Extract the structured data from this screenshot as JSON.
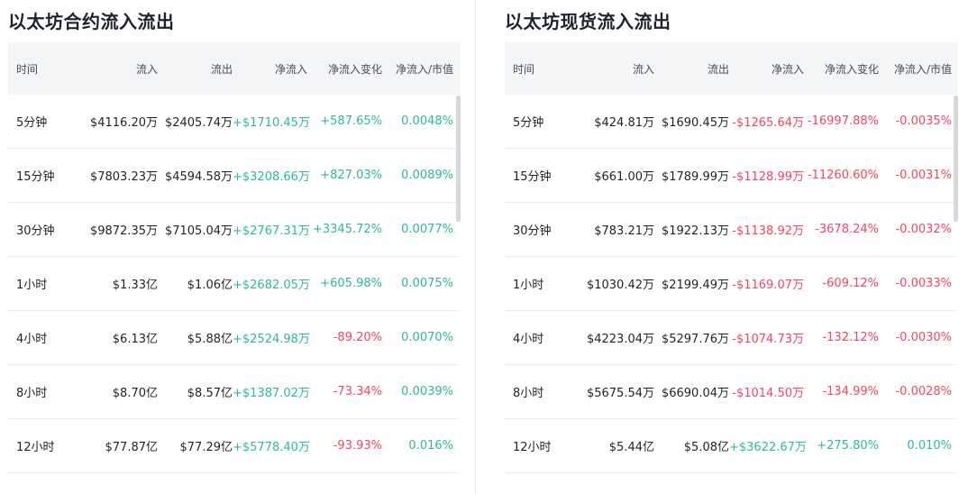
{
  "colors": {
    "positive": "#2ebd85",
    "negative": "#f6465d"
  },
  "panels": [
    {
      "title": "以太坊合约流入流出",
      "headers": [
        "时间",
        "流入",
        "流出",
        "净流入",
        "净流入变化",
        "净流入/市值"
      ],
      "rows": [
        {
          "time": "5分钟",
          "inflow": "$4116.20万",
          "outflow": "$2405.74万",
          "net": "+$1710.45万",
          "net_dir": "pos",
          "change": "+587.65%",
          "change_dir": "pos",
          "ratio": "0.0048%",
          "ratio_dir": "pos"
        },
        {
          "time": "15分钟",
          "inflow": "$7803.23万",
          "outflow": "$4594.58万",
          "net": "+$3208.66万",
          "net_dir": "pos",
          "change": "+827.03%",
          "change_dir": "pos",
          "ratio": "0.0089%",
          "ratio_dir": "pos"
        },
        {
          "time": "30分钟",
          "inflow": "$9872.35万",
          "outflow": "$7105.04万",
          "net": "+$2767.31万",
          "net_dir": "pos",
          "change": "+3345.72%",
          "change_dir": "pos",
          "ratio": "0.0077%",
          "ratio_dir": "pos"
        },
        {
          "time": "1小时",
          "inflow": "$1.33亿",
          "outflow": "$1.06亿",
          "net": "+$2682.05万",
          "net_dir": "pos",
          "change": "+605.98%",
          "change_dir": "pos",
          "ratio": "0.0075%",
          "ratio_dir": "pos"
        },
        {
          "time": "4小时",
          "inflow": "$6.13亿",
          "outflow": "$5.88亿",
          "net": "+$2524.98万",
          "net_dir": "pos",
          "change": "-89.20%",
          "change_dir": "neg",
          "ratio": "0.0070%",
          "ratio_dir": "pos"
        },
        {
          "time": "8小时",
          "inflow": "$8.70亿",
          "outflow": "$8.57亿",
          "net": "+$1387.02万",
          "net_dir": "pos",
          "change": "-73.34%",
          "change_dir": "neg",
          "ratio": "0.0039%",
          "ratio_dir": "pos"
        },
        {
          "time": "12小时",
          "inflow": "$77.87亿",
          "outflow": "$77.29亿",
          "net": "+$5778.40万",
          "net_dir": "pos",
          "change": "-93.93%",
          "change_dir": "neg",
          "ratio": "0.016%",
          "ratio_dir": "pos"
        }
      ]
    },
    {
      "title": "以太坊现货流入流出",
      "headers": [
        "时间",
        "流入",
        "流出",
        "净流入",
        "净流入变化",
        "净流入/市值"
      ],
      "rows": [
        {
          "time": "5分钟",
          "inflow": "$424.81万",
          "outflow": "$1690.45万",
          "net": "-$1265.64万",
          "net_dir": "neg",
          "change": "-16997.88%",
          "change_dir": "neg",
          "ratio": "-0.0035%",
          "ratio_dir": "neg"
        },
        {
          "time": "15分钟",
          "inflow": "$661.00万",
          "outflow": "$1789.99万",
          "net": "-$1128.99万",
          "net_dir": "neg",
          "change": "-11260.60%",
          "change_dir": "neg",
          "ratio": "-0.0031%",
          "ratio_dir": "neg"
        },
        {
          "time": "30分钟",
          "inflow": "$783.21万",
          "outflow": "$1922.13万",
          "net": "-$1138.92万",
          "net_dir": "neg",
          "change": "-3678.24%",
          "change_dir": "neg",
          "ratio": "-0.0032%",
          "ratio_dir": "neg"
        },
        {
          "time": "1小时",
          "inflow": "$1030.42万",
          "outflow": "$2199.49万",
          "net": "-$1169.07万",
          "net_dir": "neg",
          "change": "-609.12%",
          "change_dir": "neg",
          "ratio": "-0.0033%",
          "ratio_dir": "neg"
        },
        {
          "time": "4小时",
          "inflow": "$4223.04万",
          "outflow": "$5297.76万",
          "net": "-$1074.73万",
          "net_dir": "neg",
          "change": "-132.12%",
          "change_dir": "neg",
          "ratio": "-0.0030%",
          "ratio_dir": "neg"
        },
        {
          "time": "8小时",
          "inflow": "$5675.54万",
          "outflow": "$6690.04万",
          "net": "-$1014.50万",
          "net_dir": "neg",
          "change": "-134.99%",
          "change_dir": "neg",
          "ratio": "-0.0028%",
          "ratio_dir": "neg"
        },
        {
          "time": "12小时",
          "inflow": "$5.44亿",
          "outflow": "$5.08亿",
          "net": "+$3622.67万",
          "net_dir": "pos",
          "change": "+275.80%",
          "change_dir": "pos",
          "ratio": "0.010%",
          "ratio_dir": "pos"
        }
      ]
    }
  ]
}
